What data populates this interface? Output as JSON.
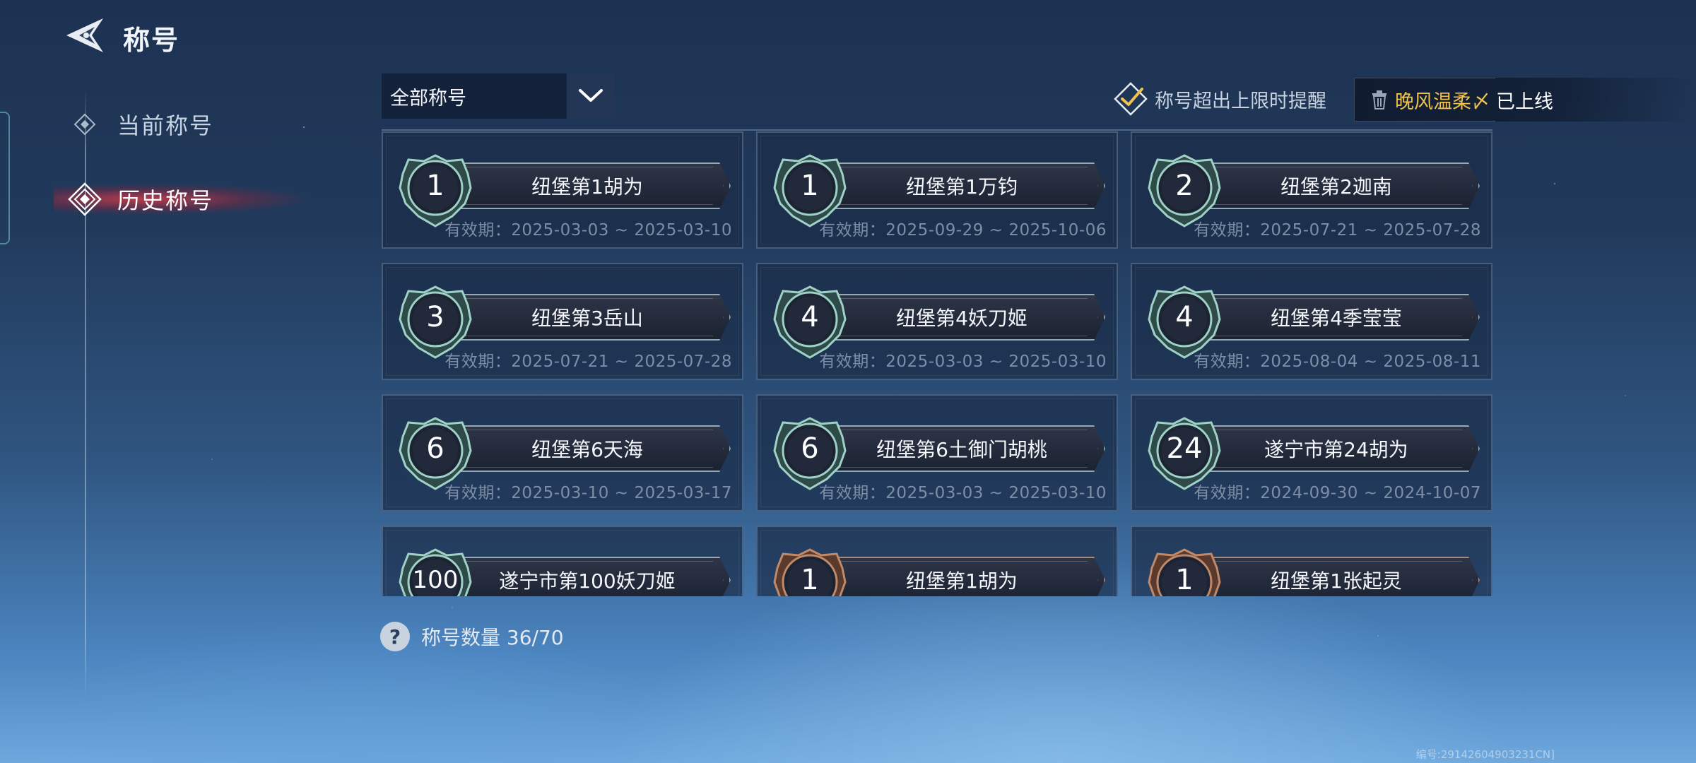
{
  "header": {
    "title": "称号"
  },
  "sidebar": {
    "items": [
      {
        "label": "当前称号",
        "active": false
      },
      {
        "label": "历史称号",
        "active": true
      }
    ]
  },
  "filter": {
    "selected": "全部称号"
  },
  "reminder": {
    "label": "称号超出上限时提醒",
    "checked": true
  },
  "notice": {
    "name": "晚风温柔〆",
    "status": "已上线"
  },
  "cards": [
    {
      "rank": "1",
      "title": "纽堡第1胡为",
      "validity": "有效期：2025-03-03 ~ 2025-03-10",
      "tier": "silver"
    },
    {
      "rank": "1",
      "title": "纽堡第1万钧",
      "validity": "有效期：2025-09-29 ~ 2025-10-06",
      "tier": "silver"
    },
    {
      "rank": "2",
      "title": "纽堡第2迦南",
      "validity": "有效期：2025-07-21 ~ 2025-07-28",
      "tier": "silver"
    },
    {
      "rank": "3",
      "title": "纽堡第3岳山",
      "validity": "有效期：2025-07-21 ~ 2025-07-28",
      "tier": "silver"
    },
    {
      "rank": "4",
      "title": "纽堡第4妖刀姬",
      "validity": "有效期：2025-03-03 ~ 2025-03-10",
      "tier": "silver"
    },
    {
      "rank": "4",
      "title": "纽堡第4季莹莹",
      "validity": "有效期：2025-08-04 ~ 2025-08-11",
      "tier": "silver"
    },
    {
      "rank": "6",
      "title": "纽堡第6天海",
      "validity": "有效期：2025-03-10 ~ 2025-03-17",
      "tier": "silver"
    },
    {
      "rank": "6",
      "title": "纽堡第6土御门胡桃",
      "validity": "有效期：2025-03-03 ~ 2025-03-10",
      "tier": "silver"
    },
    {
      "rank": "24",
      "title": "遂宁市第24胡为",
      "validity": "有效期：2024-09-30 ~ 2024-10-07",
      "tier": "silver"
    },
    {
      "rank": "100",
      "title": "遂宁市第100妖刀姬",
      "validity": "",
      "tier": "silver"
    },
    {
      "rank": "1",
      "title": "纽堡第1胡为",
      "validity": "",
      "tier": "bronze"
    },
    {
      "rank": "1",
      "title": "纽堡第1张起灵",
      "validity": "",
      "tier": "bronze"
    }
  ],
  "footer": {
    "help": "?",
    "count_text": "称号数量 36/70"
  },
  "uid": "编号:29142604903231CN]",
  "colors": {
    "accent_gold": "#f0c24d",
    "active_red": "#e33c46",
    "silver_badge": "#9fd1c6",
    "bronze_badge": "#c08a6a"
  }
}
